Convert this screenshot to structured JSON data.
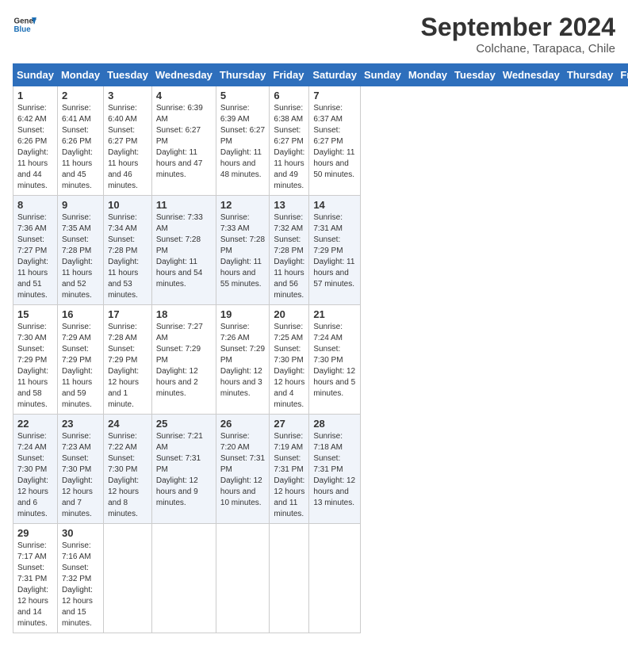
{
  "header": {
    "logo_line1": "General",
    "logo_line2": "Blue",
    "month": "September 2024",
    "location": "Colchane, Tarapaca, Chile"
  },
  "days_of_week": [
    "Sunday",
    "Monday",
    "Tuesday",
    "Wednesday",
    "Thursday",
    "Friday",
    "Saturday"
  ],
  "weeks": [
    [
      {
        "day": "1",
        "sunrise": "6:42 AM",
        "sunset": "6:26 PM",
        "daylight": "11 hours and 44 minutes."
      },
      {
        "day": "2",
        "sunrise": "6:41 AM",
        "sunset": "6:26 PM",
        "daylight": "11 hours and 45 minutes."
      },
      {
        "day": "3",
        "sunrise": "6:40 AM",
        "sunset": "6:27 PM",
        "daylight": "11 hours and 46 minutes."
      },
      {
        "day": "4",
        "sunrise": "6:39 AM",
        "sunset": "6:27 PM",
        "daylight": "11 hours and 47 minutes."
      },
      {
        "day": "5",
        "sunrise": "6:39 AM",
        "sunset": "6:27 PM",
        "daylight": "11 hours and 48 minutes."
      },
      {
        "day": "6",
        "sunrise": "6:38 AM",
        "sunset": "6:27 PM",
        "daylight": "11 hours and 49 minutes."
      },
      {
        "day": "7",
        "sunrise": "6:37 AM",
        "sunset": "6:27 PM",
        "daylight": "11 hours and 50 minutes."
      }
    ],
    [
      {
        "day": "8",
        "sunrise": "7:36 AM",
        "sunset": "7:27 PM",
        "daylight": "11 hours and 51 minutes."
      },
      {
        "day": "9",
        "sunrise": "7:35 AM",
        "sunset": "7:28 PM",
        "daylight": "11 hours and 52 minutes."
      },
      {
        "day": "10",
        "sunrise": "7:34 AM",
        "sunset": "7:28 PM",
        "daylight": "11 hours and 53 minutes."
      },
      {
        "day": "11",
        "sunrise": "7:33 AM",
        "sunset": "7:28 PM",
        "daylight": "11 hours and 54 minutes."
      },
      {
        "day": "12",
        "sunrise": "7:33 AM",
        "sunset": "7:28 PM",
        "daylight": "11 hours and 55 minutes."
      },
      {
        "day": "13",
        "sunrise": "7:32 AM",
        "sunset": "7:28 PM",
        "daylight": "11 hours and 56 minutes."
      },
      {
        "day": "14",
        "sunrise": "7:31 AM",
        "sunset": "7:29 PM",
        "daylight": "11 hours and 57 minutes."
      }
    ],
    [
      {
        "day": "15",
        "sunrise": "7:30 AM",
        "sunset": "7:29 PM",
        "daylight": "11 hours and 58 minutes."
      },
      {
        "day": "16",
        "sunrise": "7:29 AM",
        "sunset": "7:29 PM",
        "daylight": "11 hours and 59 minutes."
      },
      {
        "day": "17",
        "sunrise": "7:28 AM",
        "sunset": "7:29 PM",
        "daylight": "12 hours and 1 minute."
      },
      {
        "day": "18",
        "sunrise": "7:27 AM",
        "sunset": "7:29 PM",
        "daylight": "12 hours and 2 minutes."
      },
      {
        "day": "19",
        "sunrise": "7:26 AM",
        "sunset": "7:29 PM",
        "daylight": "12 hours and 3 minutes."
      },
      {
        "day": "20",
        "sunrise": "7:25 AM",
        "sunset": "7:30 PM",
        "daylight": "12 hours and 4 minutes."
      },
      {
        "day": "21",
        "sunrise": "7:24 AM",
        "sunset": "7:30 PM",
        "daylight": "12 hours and 5 minutes."
      }
    ],
    [
      {
        "day": "22",
        "sunrise": "7:24 AM",
        "sunset": "7:30 PM",
        "daylight": "12 hours and 6 minutes."
      },
      {
        "day": "23",
        "sunrise": "7:23 AM",
        "sunset": "7:30 PM",
        "daylight": "12 hours and 7 minutes."
      },
      {
        "day": "24",
        "sunrise": "7:22 AM",
        "sunset": "7:30 PM",
        "daylight": "12 hours and 8 minutes."
      },
      {
        "day": "25",
        "sunrise": "7:21 AM",
        "sunset": "7:31 PM",
        "daylight": "12 hours and 9 minutes."
      },
      {
        "day": "26",
        "sunrise": "7:20 AM",
        "sunset": "7:31 PM",
        "daylight": "12 hours and 10 minutes."
      },
      {
        "day": "27",
        "sunrise": "7:19 AM",
        "sunset": "7:31 PM",
        "daylight": "12 hours and 11 minutes."
      },
      {
        "day": "28",
        "sunrise": "7:18 AM",
        "sunset": "7:31 PM",
        "daylight": "12 hours and 13 minutes."
      }
    ],
    [
      {
        "day": "29",
        "sunrise": "7:17 AM",
        "sunset": "7:31 PM",
        "daylight": "12 hours and 14 minutes."
      },
      {
        "day": "30",
        "sunrise": "7:16 AM",
        "sunset": "7:32 PM",
        "daylight": "12 hours and 15 minutes."
      },
      null,
      null,
      null,
      null,
      null
    ]
  ]
}
